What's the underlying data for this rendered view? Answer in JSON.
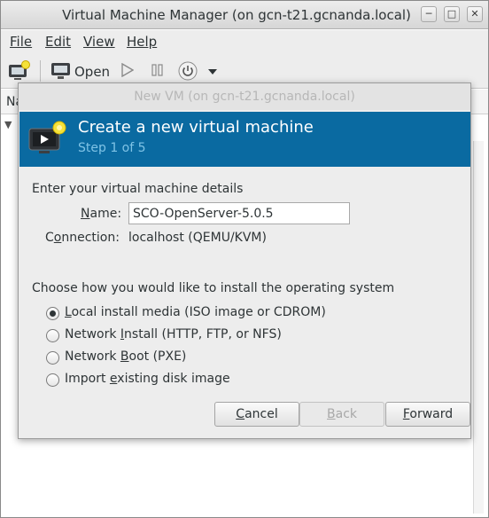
{
  "main_window": {
    "title": "Virtual Machine Manager (on gcn-t21.gcnanda.local)",
    "menu": [
      "File",
      "Edit",
      "View",
      "Help"
    ],
    "toolbar": {
      "open_label": "Open"
    },
    "list_header": "Na"
  },
  "dialog": {
    "title": "New VM (on gcn-t21.gcnanda.local)",
    "banner": {
      "heading": "Create a new virtual machine",
      "step": "Step 1 of 5",
      "color": "#0a6aa1"
    },
    "details_heading": "Enter your virtual machine details",
    "name_label_pre": "",
    "name_label_u": "N",
    "name_label_post": "ame:",
    "name_value": "SCO-OpenServer-5.0.5",
    "connection_label_pre": "C",
    "connection_label_u": "o",
    "connection_label_post": "nnection:",
    "connection_value": "localhost (QEMU/KVM)",
    "install_heading": "Choose how you would like to install the operating system",
    "options": [
      {
        "pre": "",
        "u": "L",
        "post": "ocal install media (ISO image or CDROM)",
        "checked": true
      },
      {
        "pre": "Network ",
        "u": "I",
        "post": "nstall (HTTP, FTP, or NFS)",
        "checked": false
      },
      {
        "pre": "Network ",
        "u": "B",
        "post": "oot (PXE)",
        "checked": false
      },
      {
        "pre": "Import ",
        "u": "e",
        "post": "xisting disk image",
        "checked": false
      }
    ],
    "buttons": {
      "cancel": {
        "u": "C",
        "post": "ancel"
      },
      "back": {
        "u": "B",
        "post": "ack"
      },
      "forward": {
        "u": "F",
        "post": "orward"
      }
    }
  }
}
